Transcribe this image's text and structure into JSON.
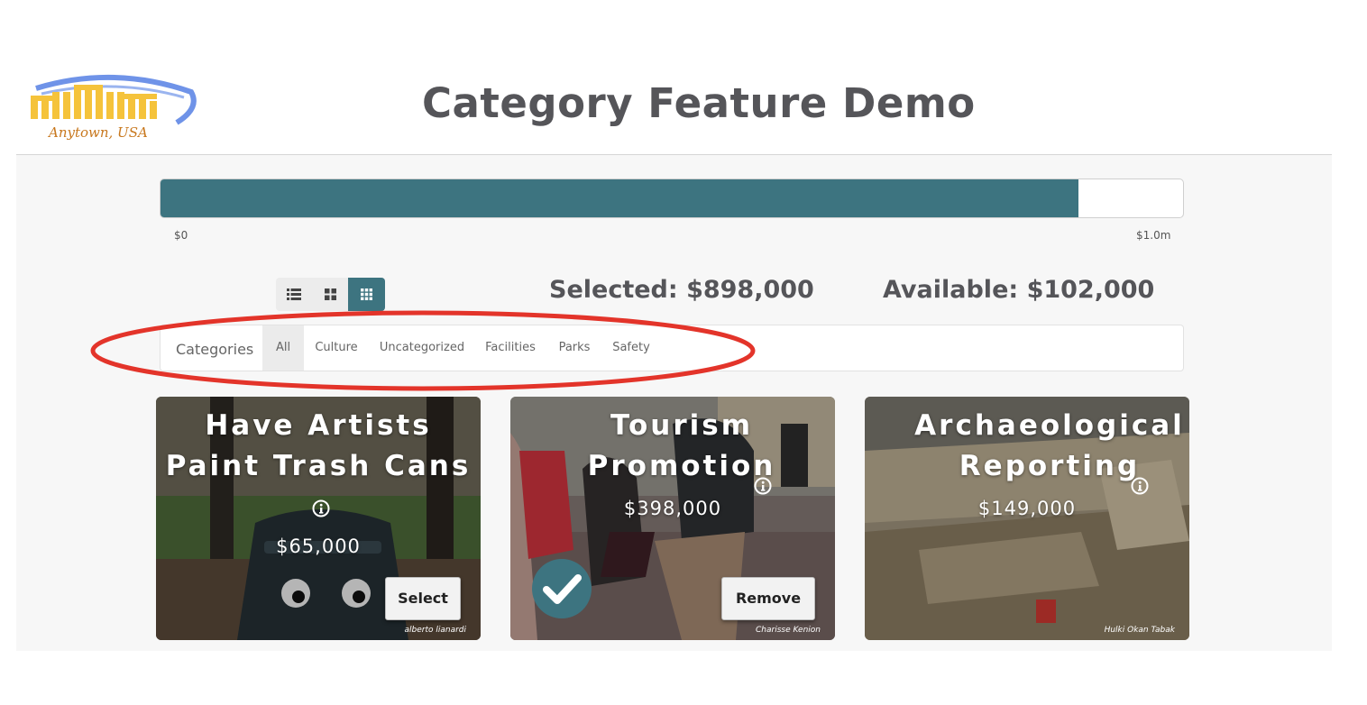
{
  "header": {
    "logo_caption": "Anytown, USA",
    "title": "Category Feature Demo"
  },
  "budget": {
    "progress_fraction": 0.898,
    "min_label": "$0",
    "max_label": "$1.0m",
    "selected_text": "Selected: $898,000",
    "available_text": "Available: $102,000",
    "fill_color": "#3d7480"
  },
  "view_toggle": {
    "options": [
      "list-view-icon",
      "large-grid-icon",
      "small-grid-icon"
    ],
    "active": "small-grid-icon"
  },
  "categories": {
    "label": "Categories",
    "items": [
      "All",
      "Culture",
      "Uncategorized",
      "Facilities",
      "Parks",
      "Safety"
    ],
    "active": "All"
  },
  "cards": [
    {
      "title": "Have Artists Paint Trash Cans",
      "price": "$65,000",
      "button": "Select",
      "credit": "alberto lianardi",
      "selected": false
    },
    {
      "title": "Tourism Promotion",
      "price": "$398,000",
      "button": "Remove",
      "credit": "Charisse Kenion",
      "selected": true
    },
    {
      "title": "Archaeological Reporting",
      "price": "$149,000",
      "button": "",
      "credit": "Hulki Okan Tabak",
      "selected": false
    }
  ],
  "colors": {
    "accent": "#3d7480",
    "highlight": "#e3342a",
    "logo_gold": "#f5c33b",
    "logo_blue": "#6f93e8"
  }
}
